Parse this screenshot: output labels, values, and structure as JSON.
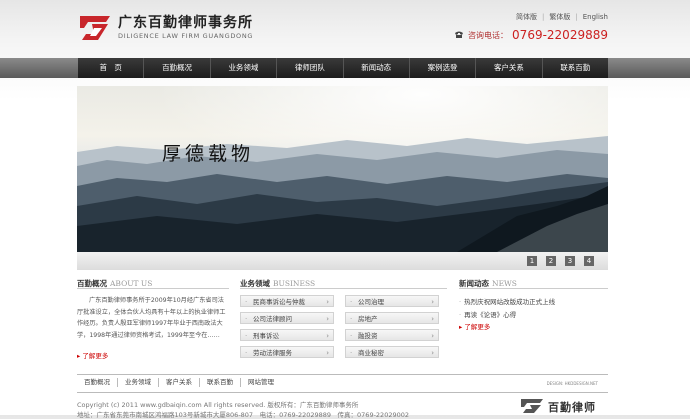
{
  "header": {
    "logo_cn": "广东百勤律师事务所",
    "logo_en": "DILIGENCE LAW FIRM GUANGDONG",
    "languages": [
      "简体版",
      "繁体版",
      "English"
    ],
    "phone_label": "咨询电话：",
    "phone": "0769-22029889"
  },
  "nav": {
    "items": [
      "首　页",
      "百勤概况",
      "业务领域",
      "律师团队",
      "新闻动态",
      "案例选登",
      "客户关系",
      "联系百勤"
    ]
  },
  "banner": {
    "title": "厚德载物",
    "pages": [
      "1",
      "2",
      "3",
      "4"
    ]
  },
  "about": {
    "title": "百勤概况",
    "title_en": "ABOUT US",
    "text": "广东百勤律师事务所于2009年10月经广东省司法厅批准设立，全体合伙人均具有十年以上的执业律师工作经历。负责人殷亚军律师1997年毕业于西南政法大学，1998年通过律师资格考试，1999年至今在……",
    "more": "了解更多"
  },
  "business": {
    "title": "业务领域",
    "title_en": "BUSINESS",
    "items": [
      "民商事诉讼与仲裁",
      "公司治理",
      "公司法律顾问",
      "房地产",
      "刑事诉讼",
      "融投资",
      "劳动法律服务",
      "商业秘密"
    ]
  },
  "news": {
    "title": "新闻动态",
    "title_en": "NEWS",
    "items": [
      "热烈庆祝网站改版成功正式上线",
      "再读《论语》心得"
    ],
    "more": "了解更多"
  },
  "footer": {
    "nav": [
      "百勤概况",
      "业务领域",
      "客户关系",
      "联系百勤",
      "网站管理"
    ],
    "design": "DESIGN: HKDDESIGN.NET",
    "copyright": "Copyright (c) 2011 www.gdbaiqin.com All rights reserved. 版权所有：广东百勤律师事务所",
    "address": "地址：广东省东莞市南城区鸿福路103号新城市大厦806-807　电话：0769-22029889　传真：0769-22029002",
    "logo_text": "百勤律师"
  },
  "colors": {
    "accent": "#cc2020",
    "nav_bg": "#222222",
    "logo_red": "#c8262b"
  }
}
